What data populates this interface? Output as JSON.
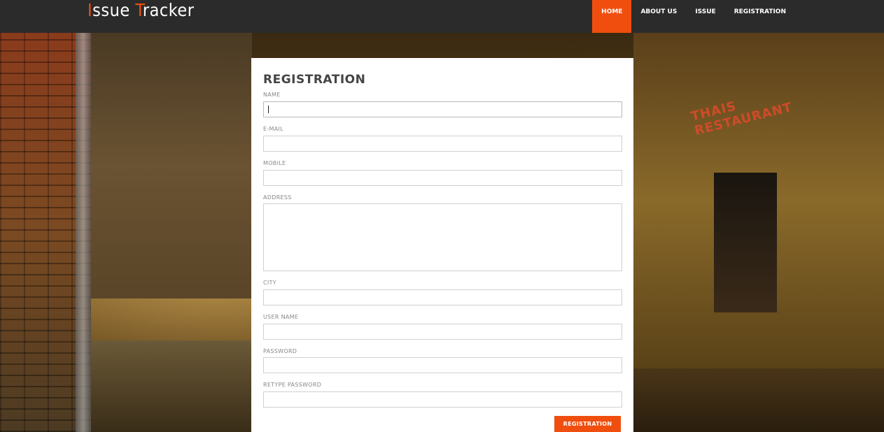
{
  "app": {
    "logo_first_letter": "I",
    "logo_rest_1": "ssue ",
    "logo_second_letter": "T",
    "logo_rest_2": "racker"
  },
  "nav": {
    "items": [
      {
        "label": "HOME",
        "active": true
      },
      {
        "label": "ABOUT US",
        "active": false
      },
      {
        "label": "ISSUE",
        "active": false
      },
      {
        "label": "REGISTRATION",
        "active": false
      }
    ]
  },
  "background": {
    "sign_text": "THAIS RESTAURANT"
  },
  "form": {
    "title": "REGISTRATION",
    "fields": {
      "name": {
        "label": "NAME",
        "value": ""
      },
      "email": {
        "label": "E-MAIL",
        "value": ""
      },
      "mobile": {
        "label": "MOBILE",
        "value": ""
      },
      "address": {
        "label": "ADDRESS",
        "value": ""
      },
      "city": {
        "label": "CITY",
        "value": ""
      },
      "username": {
        "label": "USER NAME",
        "value": ""
      },
      "password": {
        "label": "PASSWORD",
        "value": ""
      },
      "retype_password": {
        "label": "RETYPE PASSWORD",
        "value": ""
      }
    },
    "submit_label": "REGISTRATION"
  },
  "colors": {
    "accent": "#f04e0e",
    "navbar_bg": "#2b2b2b",
    "panel_bg": "#ffffff"
  }
}
